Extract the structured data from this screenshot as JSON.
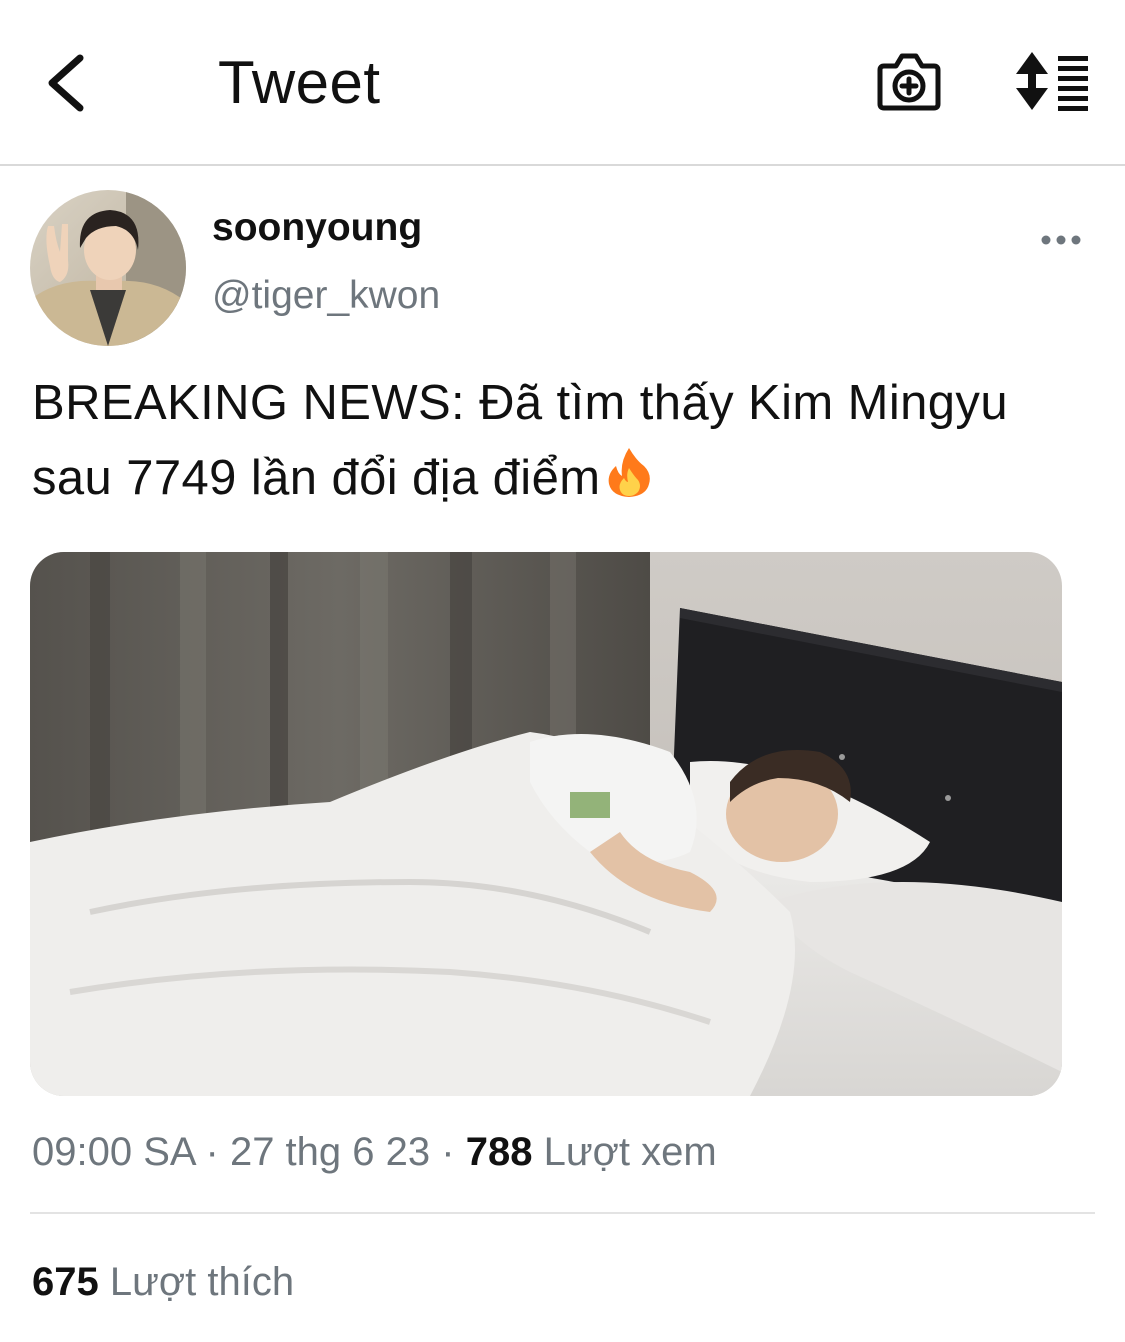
{
  "header": {
    "title": "Tweet",
    "back_icon": "chevron-left-icon",
    "camera_icon": "camera-plus-icon",
    "sort_icon": "sort-list-icon"
  },
  "author": {
    "display_name": "soonyoung",
    "handle": "@tiger_kwon",
    "more_icon": "more-horizontal-icon"
  },
  "tweet": {
    "line1": "BREAKING NEWS: Đã tìm thấy Kim Mingyu",
    "line2": "sau 7749 lần đổi địa điểm",
    "emoji_icon": "fire-icon"
  },
  "meta": {
    "time": "09:00 SA",
    "separator": "·",
    "date": "27 thg 6 23",
    "views_count": "788",
    "views_label": "Lượt xem"
  },
  "likes": {
    "count": "675",
    "label": "Lượt thích"
  },
  "colors": {
    "text_primary": "#111111",
    "text_secondary": "#6e767d",
    "divider": "#e3e3e3",
    "fire": "#ff7a1a"
  }
}
